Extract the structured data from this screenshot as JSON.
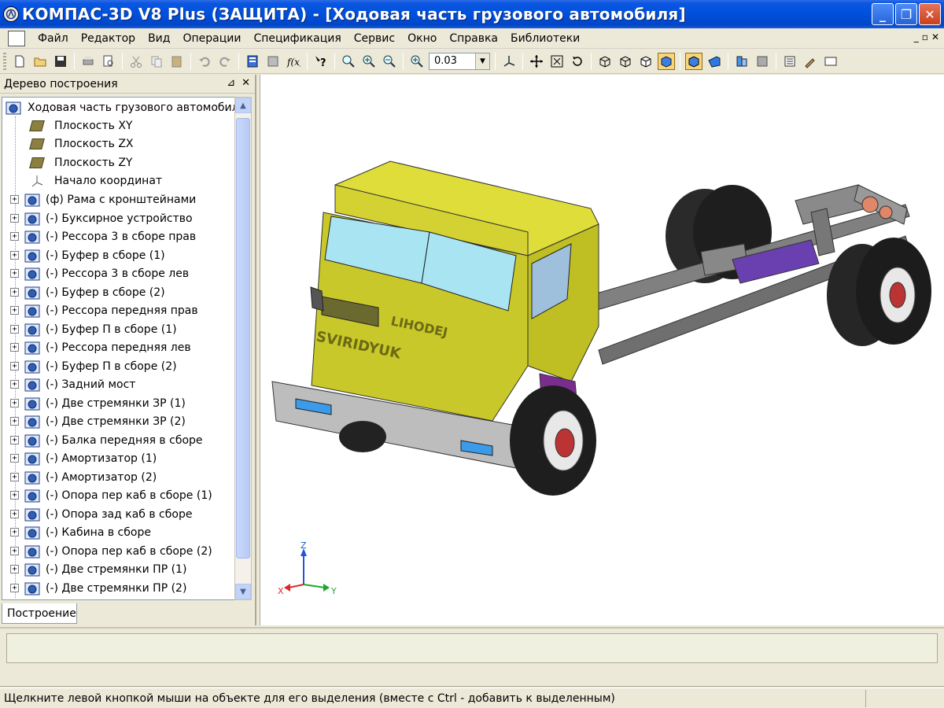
{
  "window": {
    "title": "КОМПАС-3D V8 Plus (ЗАЩИТА) - [Ходовая часть грузового автомобиля]",
    "minimize_label": "_",
    "maximize_label": "❐",
    "close_label": "✕"
  },
  "menu": {
    "items": [
      "Файл",
      "Редактор",
      "Вид",
      "Операции",
      "Спецификация",
      "Сервис",
      "Окно",
      "Справка",
      "Библиотеки"
    ],
    "mdi_minimize": "_",
    "mdi_restore": "▫",
    "mdi_close": "✕"
  },
  "toolbar": {
    "zoom_value": "0.03",
    "icons": [
      "new-icon",
      "open-icon",
      "save-icon",
      "print-icon",
      "preview-icon",
      "cut-icon",
      "copy-icon",
      "paste-icon",
      "undo-icon",
      "redo-icon",
      "variables-icon",
      "tree-icon",
      "function-icon",
      "help-icon",
      "zoom-icon",
      "zoom-in-icon",
      "zoom-out-icon",
      "zoom-to-scale-icon",
      "orientation-icon",
      "pan-icon",
      "zoom-fit-icon",
      "rotate-icon",
      "wireframe-icon",
      "hidden-lines-icon",
      "no-hidden-icon",
      "shaded-icon",
      "shaded-edges-icon",
      "perspective-icon",
      "library-icon",
      "manager-icon",
      "spec-icon",
      "tools-icon",
      "display-icon"
    ]
  },
  "tree_panel": {
    "header": "Дерево построения",
    "pin_label": "⊿",
    "close_label": "✕",
    "root": "Ходовая часть грузового автомобиля",
    "planes": [
      "Плоскость XY",
      "Плоскость ZX",
      "Плоскость ZY"
    ],
    "origin": "Начало координат",
    "components": [
      "(ф) Рама с кронштейнами",
      "(-) Буксирное устройство",
      "(-) Рессора 3 в сборе прав",
      "(-) Буфер в сборе (1)",
      "(-) Рессора 3 в сборе лев",
      "(-) Буфер в сборе (2)",
      "(-) Рессора передняя прав",
      "(-) Буфер П в сборе (1)",
      "(-) Рессора передняя лев",
      "(-) Буфер П в сборе (2)",
      "(-) Задний мост",
      "(-) Две стремянки ЗР (1)",
      "(-) Две стремянки ЗР (2)",
      "(-) Балка передняя в сборе",
      "(-) Амортизатор (1)",
      "(-) Амортизатор (2)",
      "(-) Опора пер каб в сборе (1)",
      "(-) Опора зад каб в сборе",
      "(-) Кабина в сборе",
      "(-) Опора пер каб в сборе (2)",
      "(-) Две стремянки ПР (1)",
      "(-) Две стремянки ПР (2)"
    ],
    "expander_label": "+",
    "tab_label": "Построение"
  },
  "viewport": {
    "axis_labels": {
      "x": "X",
      "y": "Y",
      "z": "Z"
    },
    "cab_text_upper": "LIHODEJ",
    "cab_text_lower": "SVIRIDYUK"
  },
  "statusbar": {
    "text": "Щелкните левой кнопкой мыши на объекте для его выделения (вместе с Ctrl - добавить к выделенным)"
  },
  "colors": {
    "titlebar": "#0050DC",
    "chrome": "#ECE9D8",
    "cab": "#C9C82A",
    "frame": "#7D7D7D",
    "fender": "#7B2D8E",
    "glass": "#A8E4F2"
  }
}
